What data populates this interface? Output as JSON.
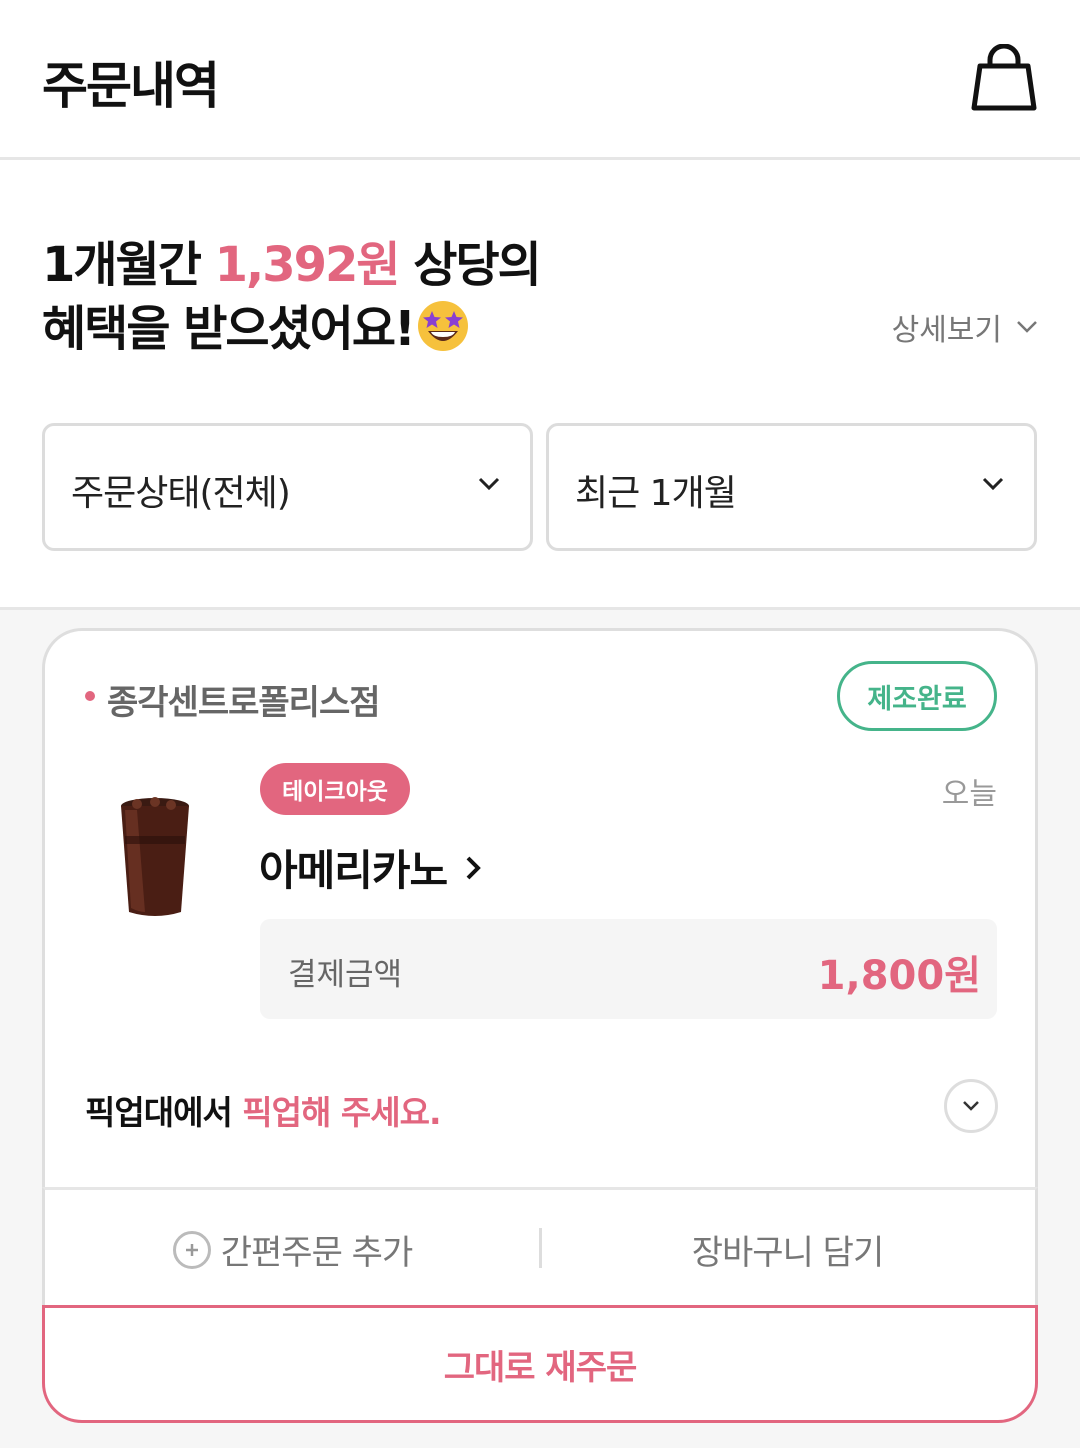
{
  "header": {
    "title": "주문내역",
    "cart_icon": "shopping-bag-icon"
  },
  "summary": {
    "line1_prefix": "1개월간 ",
    "amount": "1,392원",
    "line1_suffix": " 상당의",
    "line2": "혜택을 받으셨어요!",
    "emoji_icon": "star-struck-emoji",
    "detail_link": "상세보기"
  },
  "filters": {
    "status": "주문상태(전체)",
    "period": "최근 1개월"
  },
  "order": {
    "store": "종각센트로폴리스점",
    "status": "제조완료",
    "type": "테이크아웃",
    "date": "오늘",
    "product": "아메리카노",
    "price_label": "결제금액",
    "price": "1,800원",
    "pickup_prefix": "픽업대에서 ",
    "pickup_highlight": "픽업해 주세요.",
    "add_quick_order": "간편주문 추가",
    "add_to_cart": "장바구니 담기",
    "reorder": "그대로 재주문"
  },
  "colors": {
    "accent": "#e2667f",
    "status_green": "#45b48a"
  }
}
